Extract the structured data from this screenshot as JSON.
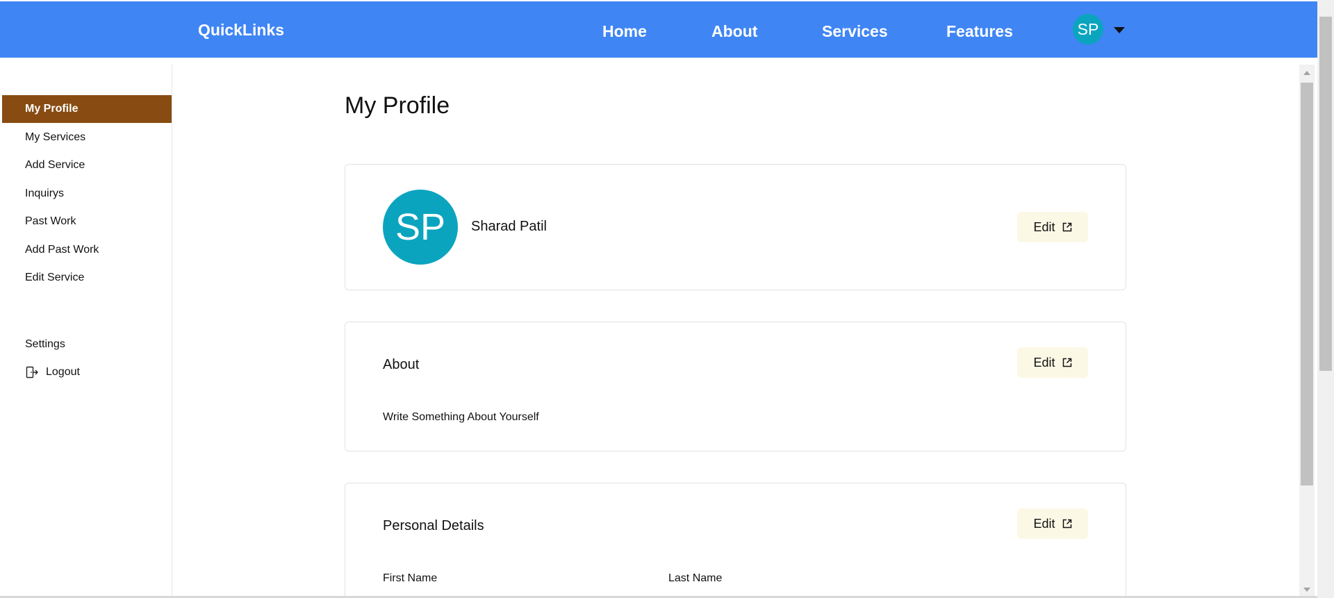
{
  "navbar": {
    "brand": "QuickLinks",
    "links": [
      "Home",
      "About",
      "Services",
      "Features"
    ],
    "avatar_initials": "SP",
    "accent_color": "#3f85f4"
  },
  "sidebar": {
    "items": [
      "My Profile",
      "My Services",
      "Add Service",
      "Inquirys",
      "Past Work",
      "Add Past Work",
      "Edit Service"
    ],
    "active_item": "My Profile",
    "active_color": "#884c12",
    "settings_label": "Settings",
    "logout_label": "Logout",
    "logout_icon": "logout-icon"
  },
  "main": {
    "title": "My Profile",
    "profile_card": {
      "avatar_initials": "SP",
      "avatar_color": "#0ba4bf",
      "name": "Sharad Patil",
      "edit_label": "Edit",
      "edit_icon": "edit-icon"
    },
    "about_card": {
      "heading": "About",
      "text": "Write Something About Yourself",
      "edit_label": "Edit"
    },
    "personal_details_card": {
      "heading": "Personal Details",
      "edit_label": "Edit",
      "first_name_label": "First Name",
      "last_name_label": "Last Name"
    }
  }
}
